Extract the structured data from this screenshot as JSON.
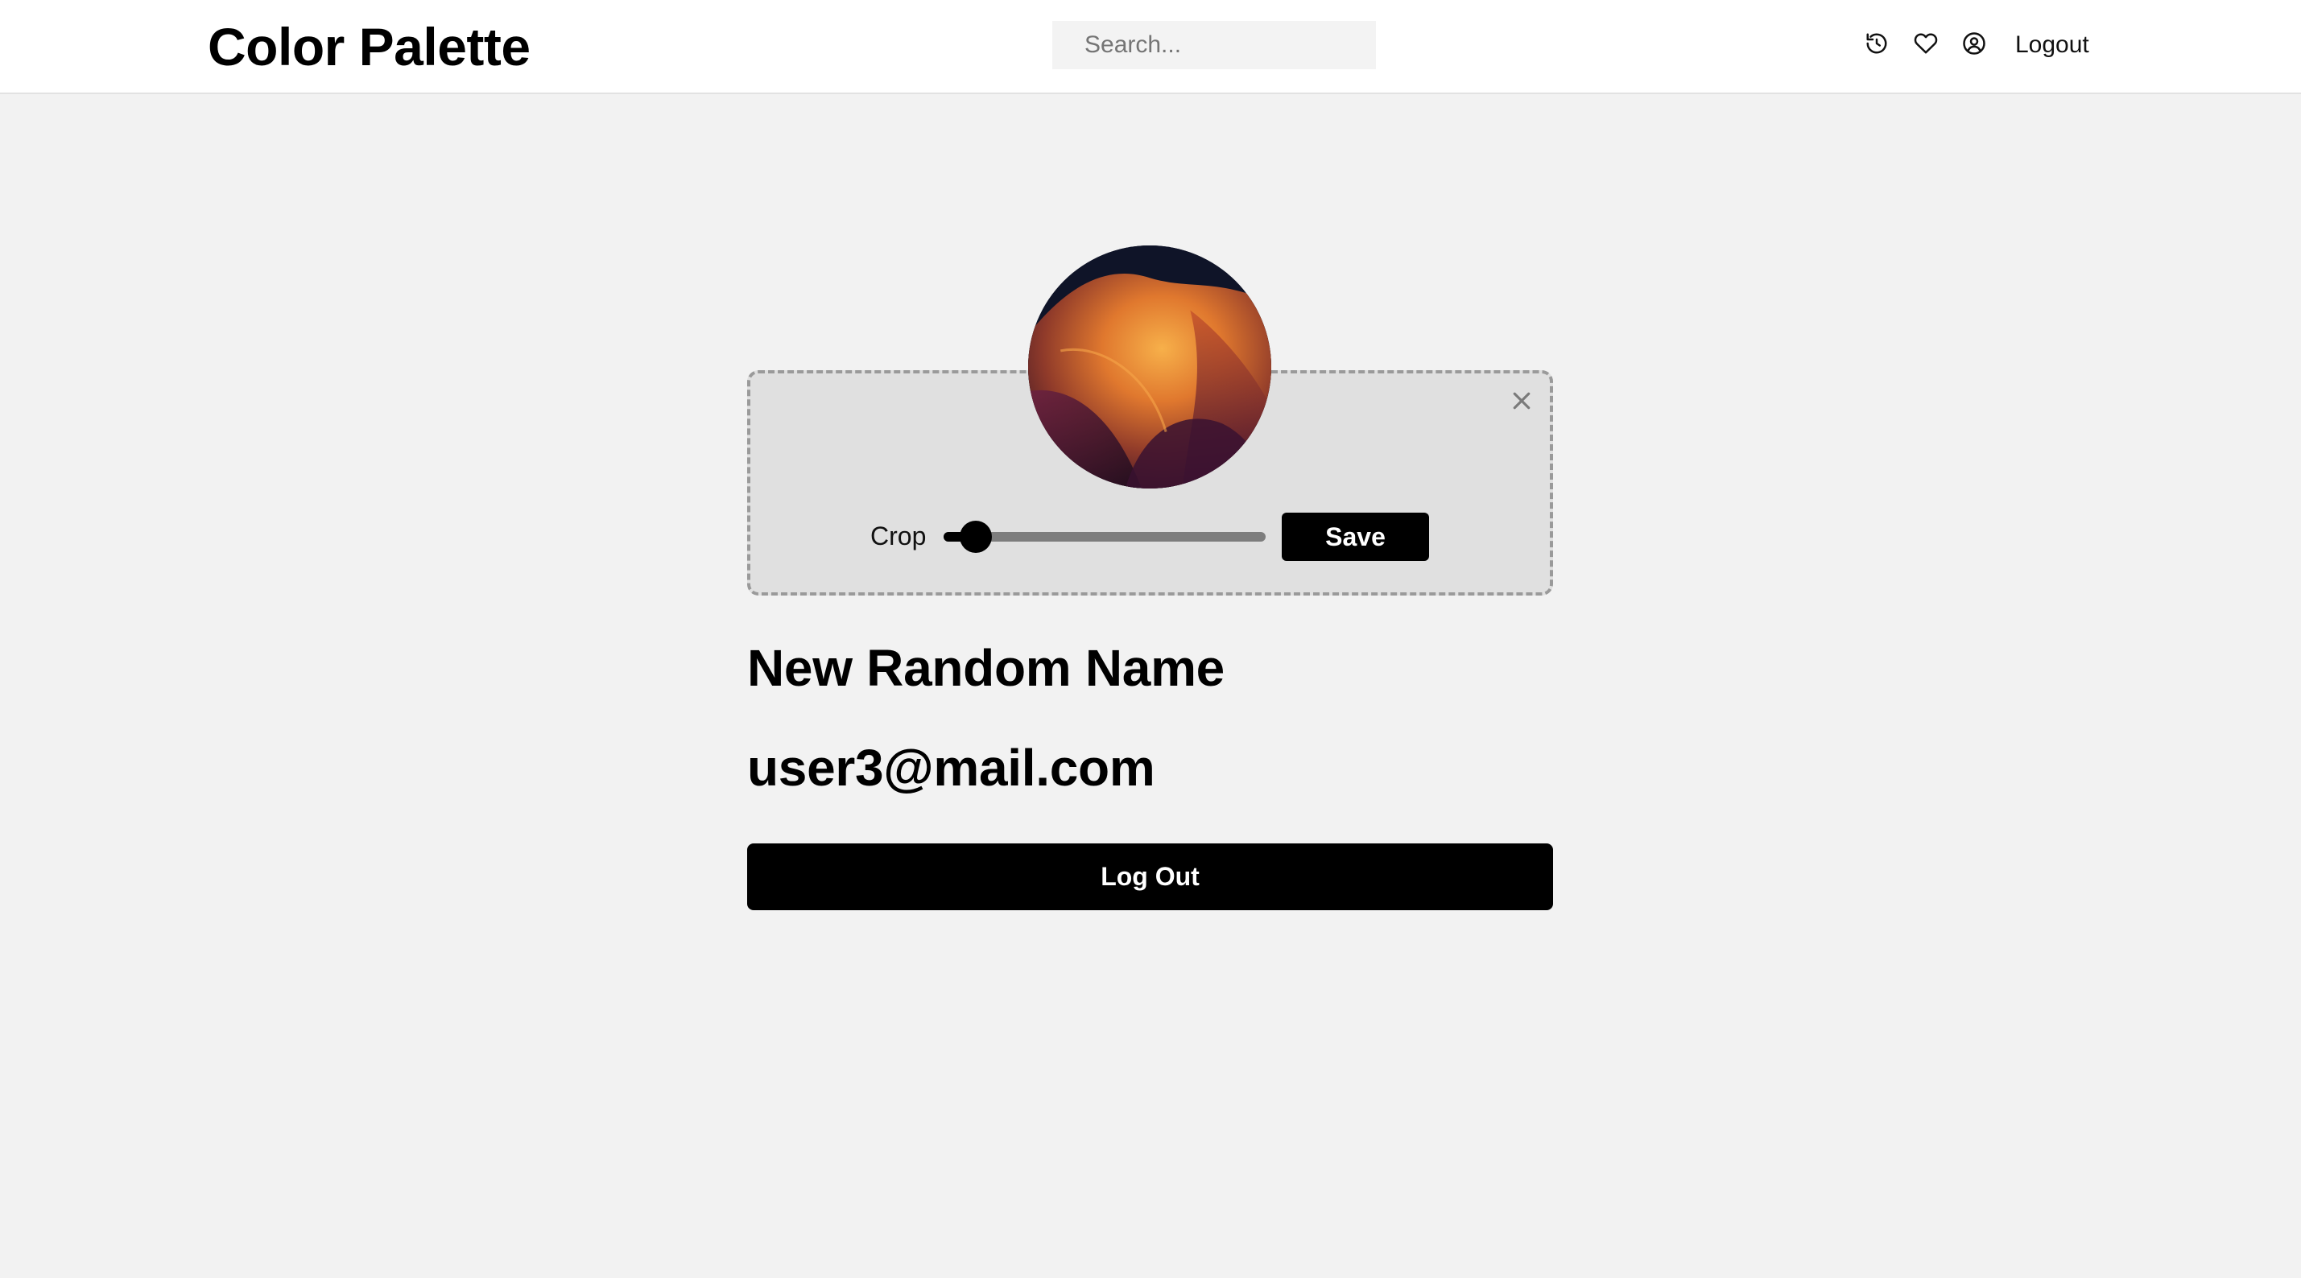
{
  "header": {
    "logo": "Color Palette",
    "search_placeholder": "Search...",
    "icons": [
      "history-icon",
      "heart-icon",
      "user-circle-icon"
    ],
    "logout_label": "Logout"
  },
  "profile": {
    "crop_label": "Crop",
    "crop_value": 0.05,
    "save_label": "Save",
    "name": "New Random Name",
    "email": "user3@mail.com",
    "logout_button_label": "Log Out"
  },
  "colors": {
    "primary": "#000000",
    "page_background": "#f2f2f2",
    "crop_area_background": "#e0e0e0"
  }
}
